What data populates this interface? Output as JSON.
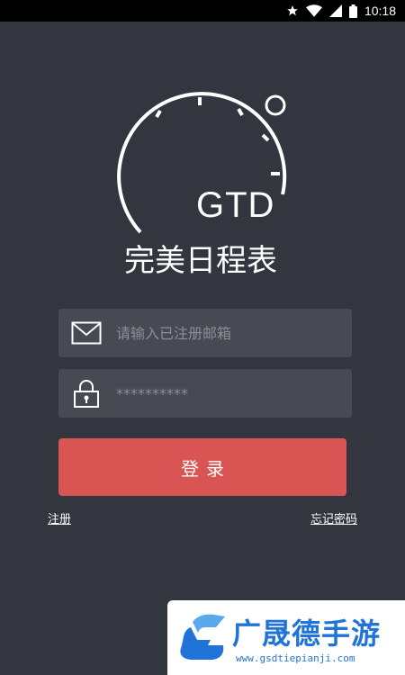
{
  "status_bar": {
    "time": "10:18",
    "icons": [
      "star-icon",
      "wifi-icon",
      "signal-icon",
      "battery-icon"
    ]
  },
  "logo": {
    "mark": "GTD",
    "app_name": "完美日程表"
  },
  "form": {
    "email_placeholder": "请输入已注册邮箱",
    "email_icon": "mail-icon",
    "password_value": "**********",
    "password_icon": "lock-icon",
    "login_label": "登录"
  },
  "links": {
    "register": "注册",
    "forgot_password": "忘记密码"
  },
  "watermark": {
    "name": "广晟德手游",
    "url": "www.gsdtiepianji.com"
  },
  "colors": {
    "background": "#33353f",
    "field": "#474953",
    "button": "#d85553",
    "watermark_blue": "#1f73d9"
  }
}
